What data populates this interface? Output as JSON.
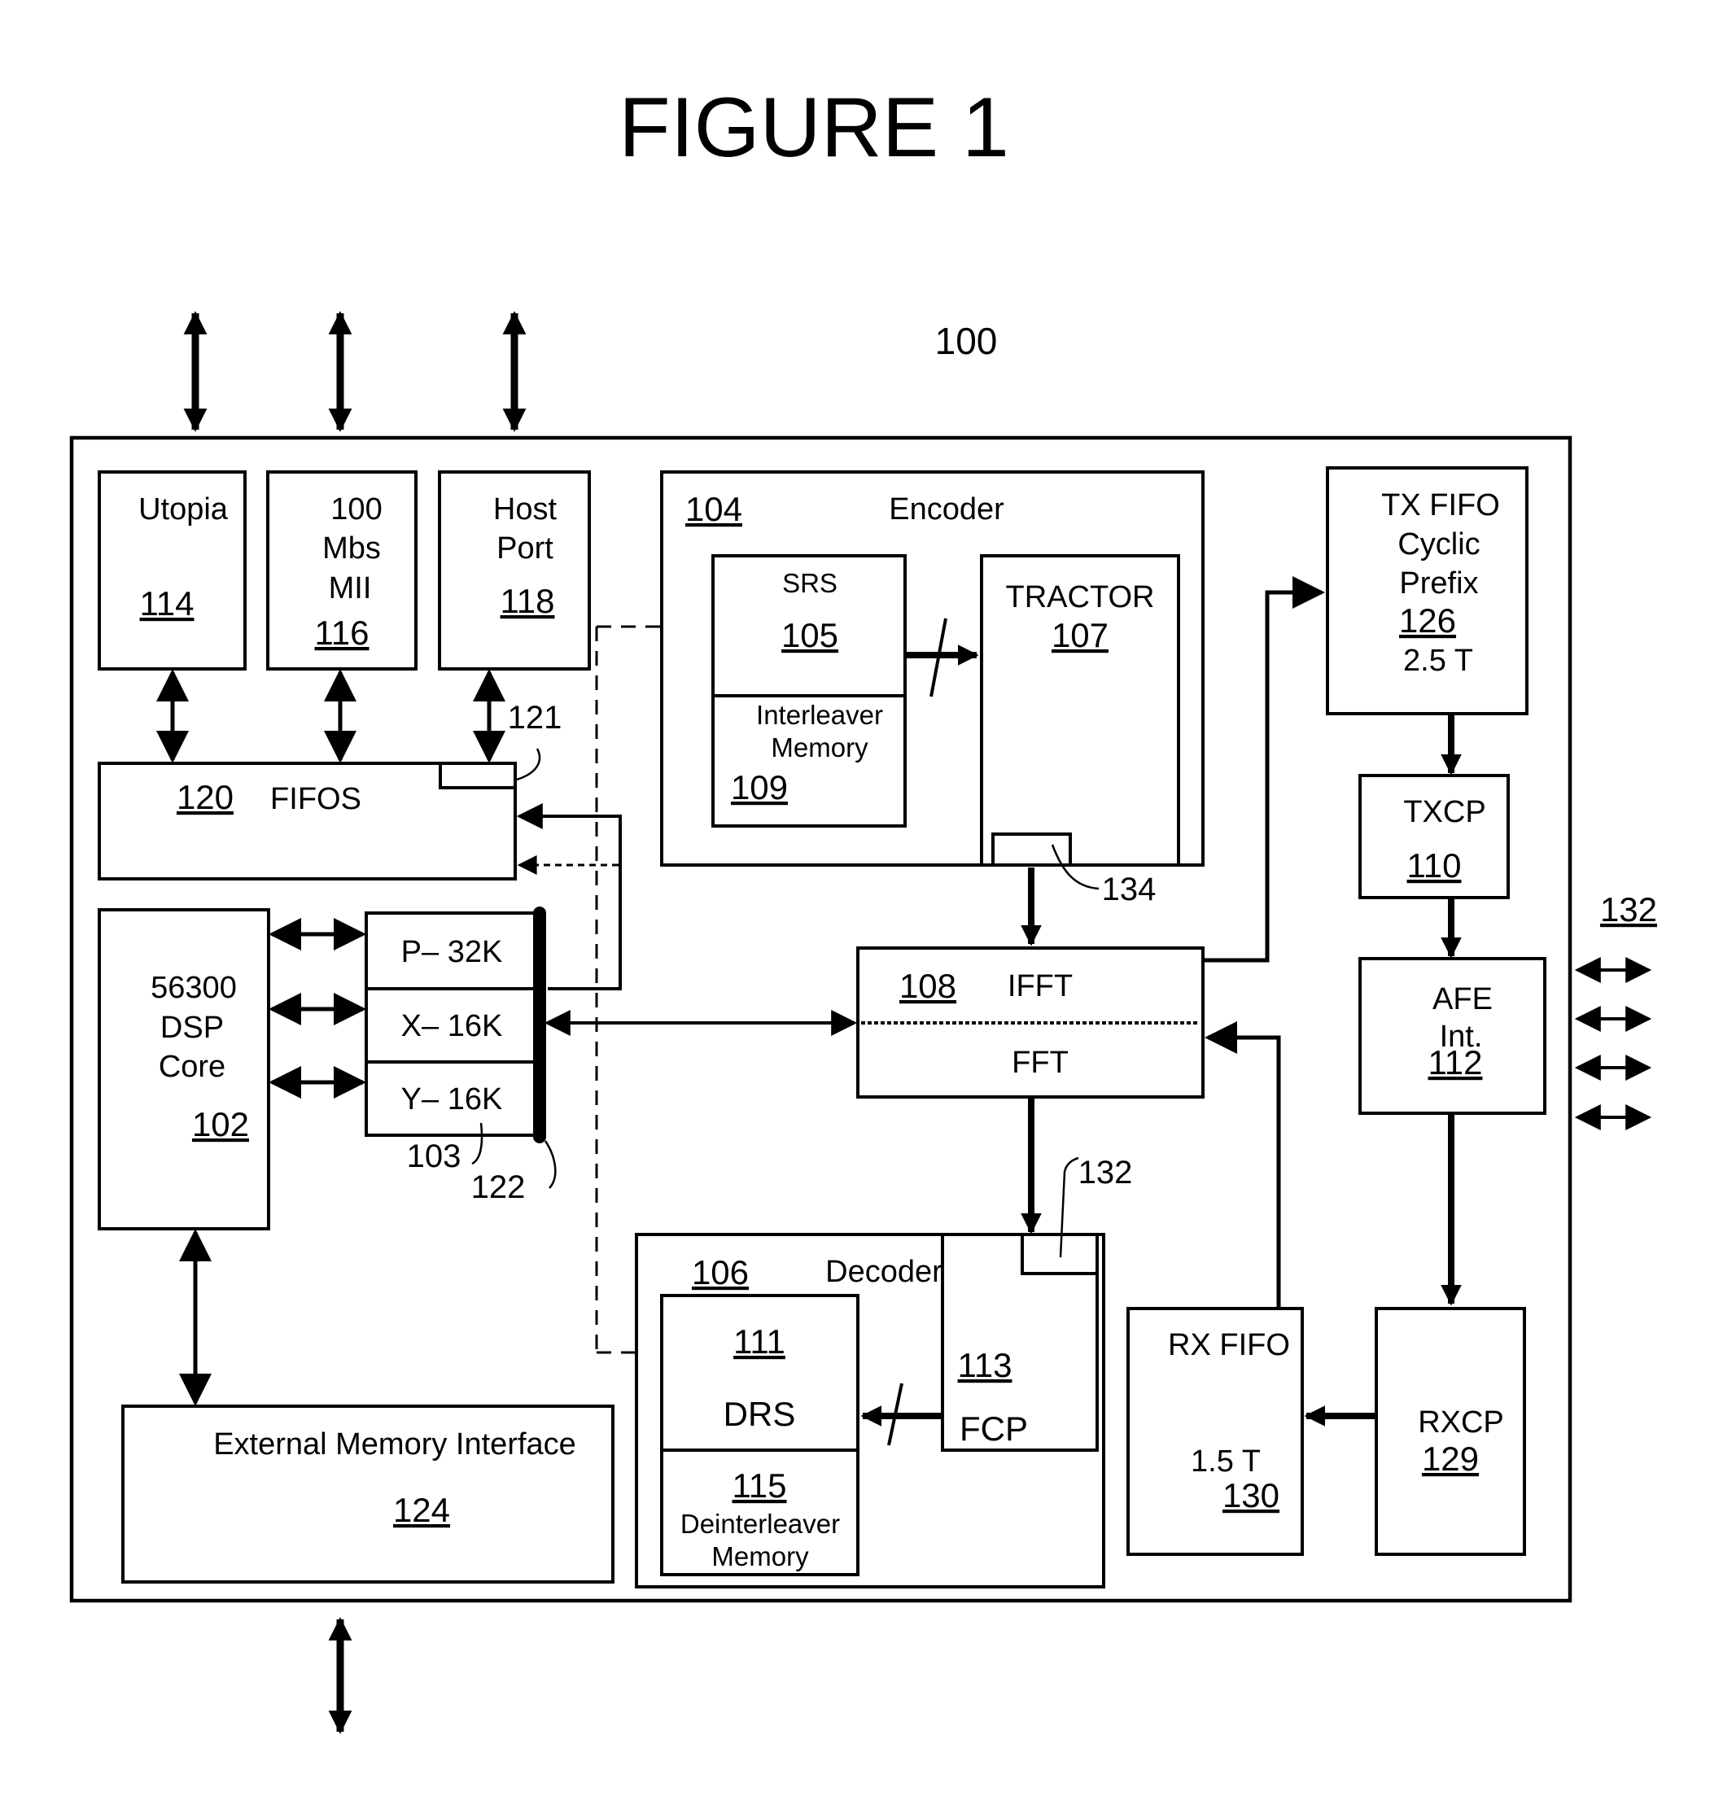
{
  "figure": {
    "title": "FIGURE 1",
    "system_ref": "100"
  },
  "blocks": {
    "utopia": {
      "label": "Utopia",
      "ref": "114"
    },
    "mii": {
      "label_lines": [
        "100",
        "Mbs",
        "MII"
      ],
      "ref": "116"
    },
    "host_port": {
      "label_lines": [
        "Host",
        "Port"
      ],
      "ref": "118"
    },
    "fifos": {
      "label": "FIFOS",
      "ref": "120",
      "sub_ref": "121"
    },
    "encoder": {
      "label": "Encoder",
      "ref": "104"
    },
    "srs": {
      "label": "SRS",
      "ref": "105"
    },
    "interleaver": {
      "label_lines": [
        "Interleaver",
        "Memory"
      ],
      "ref": "109"
    },
    "tractor": {
      "label": "TRACTOR",
      "ref": "107",
      "sub_ref": "134"
    },
    "tx_fifo": {
      "label_lines": [
        "TX FIFO",
        "Cyclic",
        "Prefix"
      ],
      "ref": "126",
      "size": "2.5 T"
    },
    "txcp": {
      "label": "TXCP",
      "ref": "110"
    },
    "afe": {
      "label_lines": [
        "AFE",
        "Int."
      ],
      "ref": "112"
    },
    "dsp_core": {
      "label_lines": [
        "56300",
        "DSP",
        "Core"
      ],
      "ref": "102"
    },
    "memory": {
      "rows": [
        "P– 32K",
        "X– 16K",
        "Y– 16K"
      ],
      "ref": "103",
      "bus_ref": "122"
    },
    "ifft_fft": {
      "ref": "108",
      "top_label": "IFFT",
      "bottom_label": "FFT"
    },
    "decoder": {
      "label": "Decoder",
      "ref": "106"
    },
    "drs": {
      "ref": "111",
      "label": "DRS"
    },
    "deinterleaver": {
      "ref": "115",
      "label_lines": [
        "Deinterleaver",
        "Memory"
      ]
    },
    "fcp": {
      "ref": "113",
      "label": "FCP",
      "sub_ref": "132"
    },
    "rx_fifo": {
      "label": "RX FIFO",
      "size": "1.5 T",
      "ref": "130"
    },
    "rxcp": {
      "label": "RXCP",
      "ref": "129"
    },
    "ext_mem": {
      "label": "External Memory Interface",
      "ref": "124"
    },
    "afe_lines": {
      "ref": "132"
    }
  }
}
